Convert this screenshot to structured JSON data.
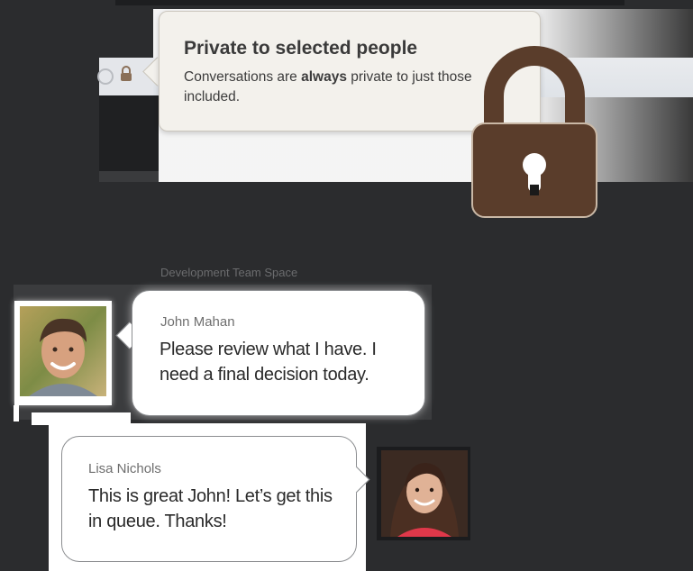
{
  "tooltip": {
    "title": "Private to selected people",
    "body_before": "Conversations are ",
    "body_bold": "always",
    "body_after": " private to just those included."
  },
  "space": {
    "label": "Development Team Space"
  },
  "messages": [
    {
      "author": "John Mahan",
      "text": "Please review what I have. I need a final decision today."
    },
    {
      "author": "Lisa Nichols",
      "text": "This is great John!  Let’s get this in queue. Thanks!"
    }
  ],
  "icons": {
    "lock": "lock-icon",
    "lock_color": "#5a3d2b"
  }
}
